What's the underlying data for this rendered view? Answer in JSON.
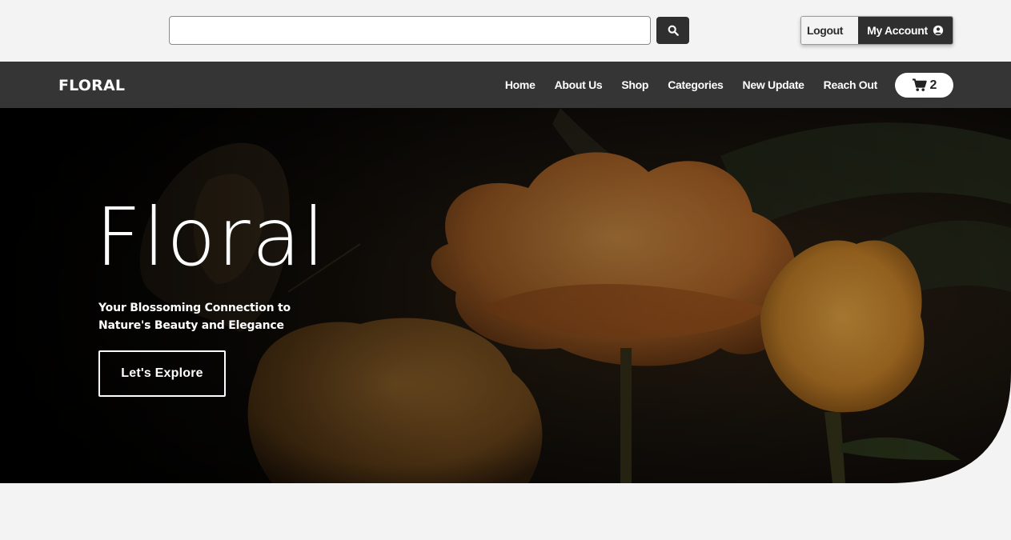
{
  "search": {
    "value": "",
    "placeholder": ""
  },
  "account": {
    "logout_label": "Logout",
    "my_account_label": "My Account"
  },
  "brand": {
    "logo_text": "FLORAL"
  },
  "nav": {
    "links": [
      {
        "label": "Home"
      },
      {
        "label": "About Us"
      },
      {
        "label": "Shop"
      },
      {
        "label": "Categories"
      },
      {
        "label": "New Update"
      },
      {
        "label": "Reach Out"
      }
    ],
    "cart_count": "2"
  },
  "hero": {
    "title": "Floral",
    "subtitle": "Your Blossoming Connection to Nature's Beauty and Elegance",
    "cta_label": "Let's Explore",
    "image": "dark photo of orange flowers with a butterfly"
  },
  "colors": {
    "page_bg": "#f3f3f3",
    "navbar_bg": "#353535",
    "button_dark": "#2f2f2f",
    "flower_orange": "#e79a46",
    "text_light": "#ffffff"
  },
  "icons": {
    "search": "search-icon",
    "account": "user-circle-icon",
    "cart": "cart-icon"
  }
}
